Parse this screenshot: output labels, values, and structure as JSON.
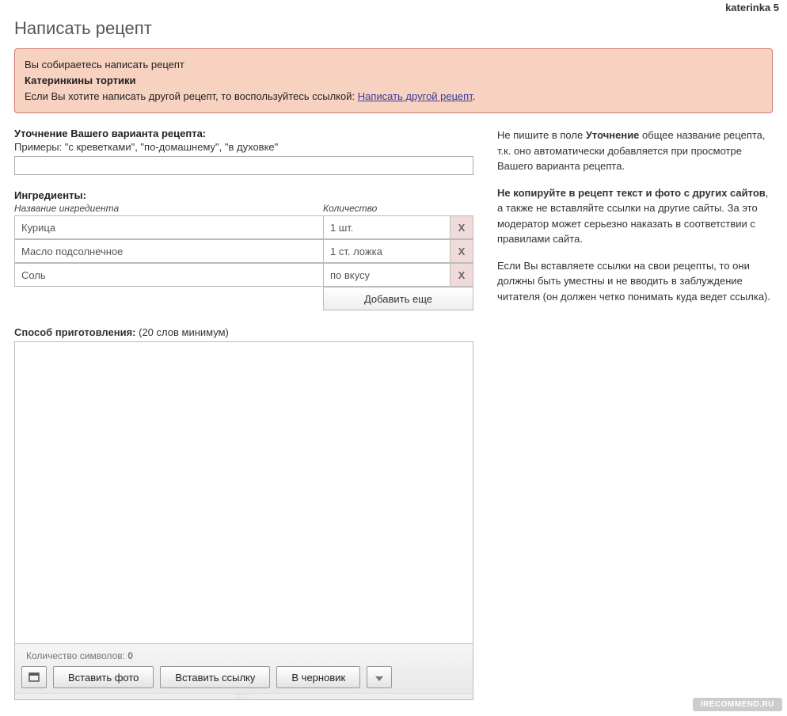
{
  "user": {
    "name": "katerinka 5"
  },
  "page": {
    "title": "Написать рецепт"
  },
  "notice": {
    "line1": "Вы собираетесь написать рецепт",
    "recipe_name": "Катеринкины тортики",
    "line2_pre": "Если Вы хотите написать другой рецепт, то воспользуйтесь ссылкой: ",
    "link_text": "Написать другой рецепт",
    "line2_post": "."
  },
  "variant": {
    "label": "Уточнение Вашего варианта рецепта:",
    "hint": "Примеры: \"с креветками\", \"по-домашнему\", \"в духовке\"",
    "value": ""
  },
  "ingredients": {
    "label": "Ингредиенты:",
    "col_name": "Название ингредиента",
    "col_qty": "Количество",
    "rows": [
      {
        "name": "Курица",
        "qty": "1 шт."
      },
      {
        "name": "Масло подсолнечное",
        "qty": "1 ст. ложка"
      },
      {
        "name": "Соль",
        "qty": "по вкусу"
      }
    ],
    "delete_label": "X",
    "add_label": "Добавить еще"
  },
  "method": {
    "label": "Способ приготовления:",
    "note": "(20 слов минимум)",
    "char_label": "Количество символов: ",
    "char_count": "0",
    "btn_photo": "Вставить фото",
    "btn_link": "Вставить ссылку",
    "btn_draft": "В черновик"
  },
  "tips": {
    "p1_a": "Не пишите в поле ",
    "p1_b": "Уточнение",
    "p1_c": " общее название рецепта, т.к. оно автоматически добавляется при просмотре Вашего варианта рецепта.",
    "p2_a": "Не копируйте в рецепт текст и фото с других сайтов",
    "p2_b": ", а также не вставляйте ссылки на другие сайты. За это модератор может серьезно наказать в соответствии с правилами сайта.",
    "p3": "Если Вы вставляете ссылки на свои рецепты, то они должны быть уместны и не вводить в заблуждение читателя (он должен четко понимать куда ведет ссылка)."
  },
  "watermark": "IRECOMMEND.RU"
}
